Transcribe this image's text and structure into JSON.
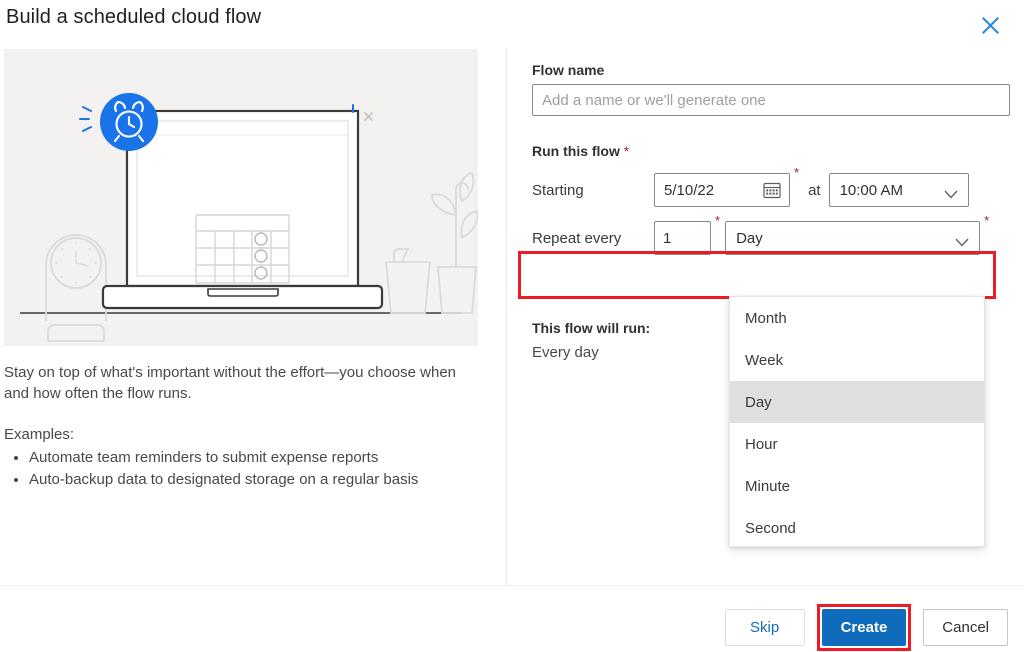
{
  "dialog": {
    "title": "Build a scheduled cloud flow",
    "close_icon": "close-icon"
  },
  "left_panel": {
    "illustration": {
      "name": "scheduled-flow-illustration",
      "badge_icon": "alarm-clock-icon",
      "background_color": "#f3f2f1",
      "accent_color": "#1a73e8"
    },
    "lead_text": "Stay on top of what's important without the effort—you choose when and how often the flow runs.",
    "examples_label": "Examples:",
    "examples": [
      "Automate team reminders to submit expense reports",
      "Auto-backup data to designated storage on a regular basis"
    ]
  },
  "form": {
    "flow_name": {
      "label": "Flow name",
      "placeholder": "Add a name or we'll generate one",
      "value": ""
    },
    "run_this_flow": {
      "label": "Run this flow",
      "required_marker": "*"
    },
    "starting": {
      "label": "Starting",
      "date_value": "5/10/22",
      "calendar_icon": "calendar-icon",
      "required_marker": "*",
      "at_label": "at",
      "time_value": "10:00 AM",
      "time_chevron_icon": "chevron-down-icon"
    },
    "repeat_every": {
      "label": "Repeat every",
      "interval_value": "1",
      "required_marker": "*",
      "unit_value": "Day",
      "unit_chevron_icon": "chevron-down-icon",
      "trailing_required_marker": "*",
      "highlight_color": "#ec1c24"
    },
    "unit_dropdown": {
      "options": [
        "Month",
        "Week",
        "Day",
        "Hour",
        "Minute",
        "Second"
      ],
      "selected": "Day"
    },
    "summary": {
      "heading": "This flow will run:",
      "value": "Every day"
    }
  },
  "footer": {
    "skip_label": "Skip",
    "create_label": "Create",
    "cancel_label": "Cancel",
    "create_highlight_color": "#ec1c24",
    "primary_color": "#0f6cbd"
  }
}
